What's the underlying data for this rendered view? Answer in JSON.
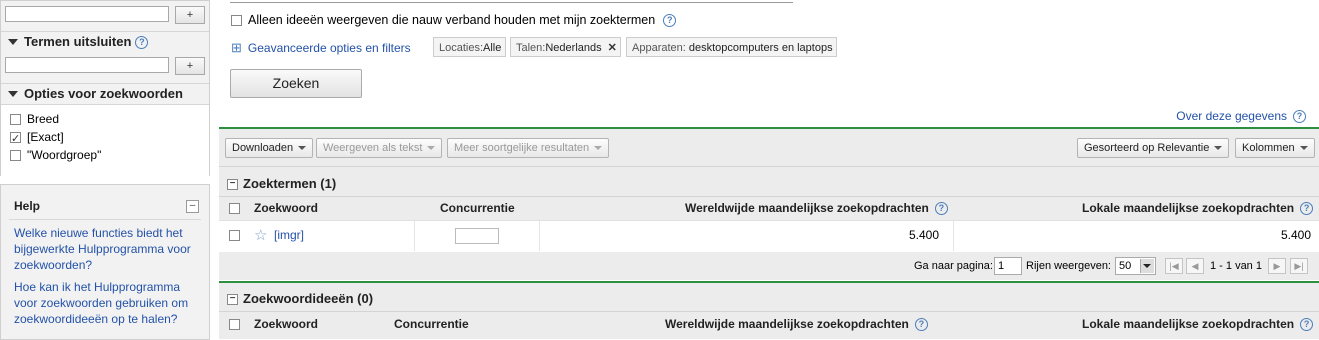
{
  "sidebar": {
    "add_button_label": "+",
    "exclude_header": "Termen uitsluiten",
    "match_header": "Opties voor zoekwoorden",
    "match_options": [
      {
        "label": "Breed",
        "checked": false
      },
      {
        "label": "[Exact]",
        "checked": true
      },
      {
        "label": "\"Woordgroep\"",
        "checked": false
      }
    ],
    "help_title": "Help",
    "help_collapse": "–",
    "help_links": [
      "Welke nieuwe functies biedt het bijgewerkte Hulpprogramma voor zoekwoorden?",
      "Hoe kan ik het Hulpprogramma voor zoekwoorden gebruiken om zoekwoordideeën op te halen?"
    ]
  },
  "search": {
    "only_related_label": "Alleen ideeën weergeven die nauw verband houden met mijn zoektermen",
    "only_related_checked": false,
    "advanced_label": "Geavanceerde opties en filters",
    "advanced_icon": "⊞",
    "chips": {
      "locations_key": "Locaties:",
      "locations_value": "Alle",
      "languages_key": "Talen:",
      "languages_value": "Nederlands",
      "remove_symbol": "✕",
      "devices_key": "Apparaten:",
      "devices_value": "desktopcomputers en laptops"
    },
    "search_button": "Zoeken",
    "about_data": "Over deze gegevens"
  },
  "toolbar": {
    "download": "Downloaden",
    "view_text": "Weergeven als tekst",
    "more_like": "Meer soortgelijke resultaten",
    "sort": "Gesorteerd op Relevantie",
    "columns": "Kolommen"
  },
  "search_terms": {
    "title": "Zoektermen (1)",
    "columns": {
      "keyword": "Zoekwoord",
      "competition": "Concurrentie",
      "global": "Wereldwijde maandelijkse zoekopdrachten",
      "local": "Lokale maandelijkse zoekopdrachten"
    },
    "rows": [
      {
        "keyword": "[imgr]",
        "competition_level": 0,
        "global": "5.400",
        "local": "5.400"
      }
    ]
  },
  "pager": {
    "goto_label": "Ga naar pagina:",
    "page_value": "1",
    "rows_label": "Rijen weergeven:",
    "rows_value": "50",
    "range": "1 - 1 van 1"
  },
  "keyword_ideas": {
    "title": "Zoekwoordideeën (0)",
    "columns": {
      "keyword": "Zoekwoord",
      "competition": "Concurrentie",
      "global": "Wereldwijde maandelijkse zoekopdrachten",
      "local": "Lokale maandelijkse zoekopdrachten"
    }
  },
  "colors": {
    "link": "#2352a8",
    "accent_green": "#2c8f3f",
    "panel_gray": "#ececec"
  }
}
